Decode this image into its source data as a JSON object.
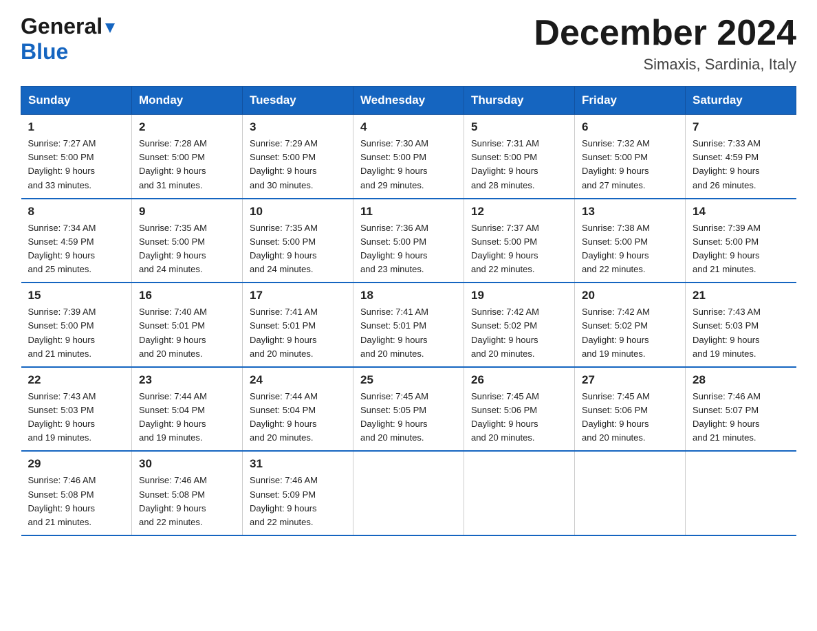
{
  "header": {
    "logo_general": "General",
    "logo_blue": "Blue",
    "month_title": "December 2024",
    "location": "Simaxis, Sardinia, Italy"
  },
  "days_of_week": [
    "Sunday",
    "Monday",
    "Tuesday",
    "Wednesday",
    "Thursday",
    "Friday",
    "Saturday"
  ],
  "weeks": [
    [
      {
        "day": "1",
        "sunrise": "7:27 AM",
        "sunset": "5:00 PM",
        "daylight": "9 hours and 33 minutes."
      },
      {
        "day": "2",
        "sunrise": "7:28 AM",
        "sunset": "5:00 PM",
        "daylight": "9 hours and 31 minutes."
      },
      {
        "day": "3",
        "sunrise": "7:29 AM",
        "sunset": "5:00 PM",
        "daylight": "9 hours and 30 minutes."
      },
      {
        "day": "4",
        "sunrise": "7:30 AM",
        "sunset": "5:00 PM",
        "daylight": "9 hours and 29 minutes."
      },
      {
        "day": "5",
        "sunrise": "7:31 AM",
        "sunset": "5:00 PM",
        "daylight": "9 hours and 28 minutes."
      },
      {
        "day": "6",
        "sunrise": "7:32 AM",
        "sunset": "5:00 PM",
        "daylight": "9 hours and 27 minutes."
      },
      {
        "day": "7",
        "sunrise": "7:33 AM",
        "sunset": "4:59 PM",
        "daylight": "9 hours and 26 minutes."
      }
    ],
    [
      {
        "day": "8",
        "sunrise": "7:34 AM",
        "sunset": "4:59 PM",
        "daylight": "9 hours and 25 minutes."
      },
      {
        "day": "9",
        "sunrise": "7:35 AM",
        "sunset": "5:00 PM",
        "daylight": "9 hours and 24 minutes."
      },
      {
        "day": "10",
        "sunrise": "7:35 AM",
        "sunset": "5:00 PM",
        "daylight": "9 hours and 24 minutes."
      },
      {
        "day": "11",
        "sunrise": "7:36 AM",
        "sunset": "5:00 PM",
        "daylight": "9 hours and 23 minutes."
      },
      {
        "day": "12",
        "sunrise": "7:37 AM",
        "sunset": "5:00 PM",
        "daylight": "9 hours and 22 minutes."
      },
      {
        "day": "13",
        "sunrise": "7:38 AM",
        "sunset": "5:00 PM",
        "daylight": "9 hours and 22 minutes."
      },
      {
        "day": "14",
        "sunrise": "7:39 AM",
        "sunset": "5:00 PM",
        "daylight": "9 hours and 21 minutes."
      }
    ],
    [
      {
        "day": "15",
        "sunrise": "7:39 AM",
        "sunset": "5:00 PM",
        "daylight": "9 hours and 21 minutes."
      },
      {
        "day": "16",
        "sunrise": "7:40 AM",
        "sunset": "5:01 PM",
        "daylight": "9 hours and 20 minutes."
      },
      {
        "day": "17",
        "sunrise": "7:41 AM",
        "sunset": "5:01 PM",
        "daylight": "9 hours and 20 minutes."
      },
      {
        "day": "18",
        "sunrise": "7:41 AM",
        "sunset": "5:01 PM",
        "daylight": "9 hours and 20 minutes."
      },
      {
        "day": "19",
        "sunrise": "7:42 AM",
        "sunset": "5:02 PM",
        "daylight": "9 hours and 20 minutes."
      },
      {
        "day": "20",
        "sunrise": "7:42 AM",
        "sunset": "5:02 PM",
        "daylight": "9 hours and 19 minutes."
      },
      {
        "day": "21",
        "sunrise": "7:43 AM",
        "sunset": "5:03 PM",
        "daylight": "9 hours and 19 minutes."
      }
    ],
    [
      {
        "day": "22",
        "sunrise": "7:43 AM",
        "sunset": "5:03 PM",
        "daylight": "9 hours and 19 minutes."
      },
      {
        "day": "23",
        "sunrise": "7:44 AM",
        "sunset": "5:04 PM",
        "daylight": "9 hours and 19 minutes."
      },
      {
        "day": "24",
        "sunrise": "7:44 AM",
        "sunset": "5:04 PM",
        "daylight": "9 hours and 20 minutes."
      },
      {
        "day": "25",
        "sunrise": "7:45 AM",
        "sunset": "5:05 PM",
        "daylight": "9 hours and 20 minutes."
      },
      {
        "day": "26",
        "sunrise": "7:45 AM",
        "sunset": "5:06 PM",
        "daylight": "9 hours and 20 minutes."
      },
      {
        "day": "27",
        "sunrise": "7:45 AM",
        "sunset": "5:06 PM",
        "daylight": "9 hours and 20 minutes."
      },
      {
        "day": "28",
        "sunrise": "7:46 AM",
        "sunset": "5:07 PM",
        "daylight": "9 hours and 21 minutes."
      }
    ],
    [
      {
        "day": "29",
        "sunrise": "7:46 AM",
        "sunset": "5:08 PM",
        "daylight": "9 hours and 21 minutes."
      },
      {
        "day": "30",
        "sunrise": "7:46 AM",
        "sunset": "5:08 PM",
        "daylight": "9 hours and 22 minutes."
      },
      {
        "day": "31",
        "sunrise": "7:46 AM",
        "sunset": "5:09 PM",
        "daylight": "9 hours and 22 minutes."
      },
      {
        "day": "",
        "sunrise": "",
        "sunset": "",
        "daylight": ""
      },
      {
        "day": "",
        "sunrise": "",
        "sunset": "",
        "daylight": ""
      },
      {
        "day": "",
        "sunrise": "",
        "sunset": "",
        "daylight": ""
      },
      {
        "day": "",
        "sunrise": "",
        "sunset": "",
        "daylight": ""
      }
    ]
  ],
  "labels": {
    "sunrise": "Sunrise:",
    "sunset": "Sunset:",
    "daylight": "Daylight:"
  },
  "colors": {
    "header_bg": "#1565C0",
    "border": "#1252a0"
  }
}
